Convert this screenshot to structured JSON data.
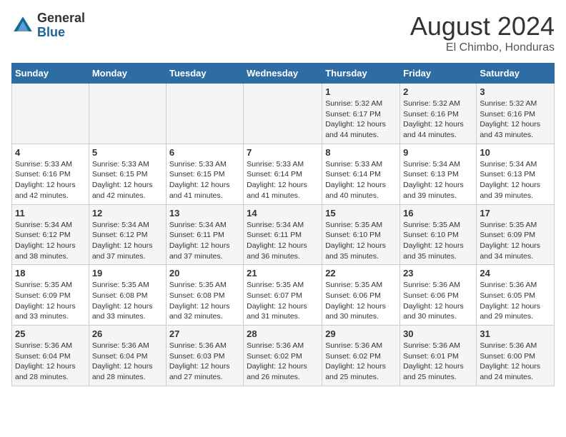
{
  "header": {
    "logo_general": "General",
    "logo_blue": "Blue",
    "title": "August 2024",
    "subtitle": "El Chimbo, Honduras"
  },
  "days_of_week": [
    "Sunday",
    "Monday",
    "Tuesday",
    "Wednesday",
    "Thursday",
    "Friday",
    "Saturday"
  ],
  "weeks": [
    [
      {
        "day": "",
        "info": ""
      },
      {
        "day": "",
        "info": ""
      },
      {
        "day": "",
        "info": ""
      },
      {
        "day": "",
        "info": ""
      },
      {
        "day": "1",
        "info": "Sunrise: 5:32 AM\nSunset: 6:17 PM\nDaylight: 12 hours\nand 44 minutes."
      },
      {
        "day": "2",
        "info": "Sunrise: 5:32 AM\nSunset: 6:16 PM\nDaylight: 12 hours\nand 44 minutes."
      },
      {
        "day": "3",
        "info": "Sunrise: 5:32 AM\nSunset: 6:16 PM\nDaylight: 12 hours\nand 43 minutes."
      }
    ],
    [
      {
        "day": "4",
        "info": "Sunrise: 5:33 AM\nSunset: 6:16 PM\nDaylight: 12 hours\nand 42 minutes."
      },
      {
        "day": "5",
        "info": "Sunrise: 5:33 AM\nSunset: 6:15 PM\nDaylight: 12 hours\nand 42 minutes."
      },
      {
        "day": "6",
        "info": "Sunrise: 5:33 AM\nSunset: 6:15 PM\nDaylight: 12 hours\nand 41 minutes."
      },
      {
        "day": "7",
        "info": "Sunrise: 5:33 AM\nSunset: 6:14 PM\nDaylight: 12 hours\nand 41 minutes."
      },
      {
        "day": "8",
        "info": "Sunrise: 5:33 AM\nSunset: 6:14 PM\nDaylight: 12 hours\nand 40 minutes."
      },
      {
        "day": "9",
        "info": "Sunrise: 5:34 AM\nSunset: 6:13 PM\nDaylight: 12 hours\nand 39 minutes."
      },
      {
        "day": "10",
        "info": "Sunrise: 5:34 AM\nSunset: 6:13 PM\nDaylight: 12 hours\nand 39 minutes."
      }
    ],
    [
      {
        "day": "11",
        "info": "Sunrise: 5:34 AM\nSunset: 6:12 PM\nDaylight: 12 hours\nand 38 minutes."
      },
      {
        "day": "12",
        "info": "Sunrise: 5:34 AM\nSunset: 6:12 PM\nDaylight: 12 hours\nand 37 minutes."
      },
      {
        "day": "13",
        "info": "Sunrise: 5:34 AM\nSunset: 6:11 PM\nDaylight: 12 hours\nand 37 minutes."
      },
      {
        "day": "14",
        "info": "Sunrise: 5:34 AM\nSunset: 6:11 PM\nDaylight: 12 hours\nand 36 minutes."
      },
      {
        "day": "15",
        "info": "Sunrise: 5:35 AM\nSunset: 6:10 PM\nDaylight: 12 hours\nand 35 minutes."
      },
      {
        "day": "16",
        "info": "Sunrise: 5:35 AM\nSunset: 6:10 PM\nDaylight: 12 hours\nand 35 minutes."
      },
      {
        "day": "17",
        "info": "Sunrise: 5:35 AM\nSunset: 6:09 PM\nDaylight: 12 hours\nand 34 minutes."
      }
    ],
    [
      {
        "day": "18",
        "info": "Sunrise: 5:35 AM\nSunset: 6:09 PM\nDaylight: 12 hours\nand 33 minutes."
      },
      {
        "day": "19",
        "info": "Sunrise: 5:35 AM\nSunset: 6:08 PM\nDaylight: 12 hours\nand 33 minutes."
      },
      {
        "day": "20",
        "info": "Sunrise: 5:35 AM\nSunset: 6:08 PM\nDaylight: 12 hours\nand 32 minutes."
      },
      {
        "day": "21",
        "info": "Sunrise: 5:35 AM\nSunset: 6:07 PM\nDaylight: 12 hours\nand 31 minutes."
      },
      {
        "day": "22",
        "info": "Sunrise: 5:35 AM\nSunset: 6:06 PM\nDaylight: 12 hours\nand 30 minutes."
      },
      {
        "day": "23",
        "info": "Sunrise: 5:36 AM\nSunset: 6:06 PM\nDaylight: 12 hours\nand 30 minutes."
      },
      {
        "day": "24",
        "info": "Sunrise: 5:36 AM\nSunset: 6:05 PM\nDaylight: 12 hours\nand 29 minutes."
      }
    ],
    [
      {
        "day": "25",
        "info": "Sunrise: 5:36 AM\nSunset: 6:04 PM\nDaylight: 12 hours\nand 28 minutes."
      },
      {
        "day": "26",
        "info": "Sunrise: 5:36 AM\nSunset: 6:04 PM\nDaylight: 12 hours\nand 28 minutes."
      },
      {
        "day": "27",
        "info": "Sunrise: 5:36 AM\nSunset: 6:03 PM\nDaylight: 12 hours\nand 27 minutes."
      },
      {
        "day": "28",
        "info": "Sunrise: 5:36 AM\nSunset: 6:02 PM\nDaylight: 12 hours\nand 26 minutes."
      },
      {
        "day": "29",
        "info": "Sunrise: 5:36 AM\nSunset: 6:02 PM\nDaylight: 12 hours\nand 25 minutes."
      },
      {
        "day": "30",
        "info": "Sunrise: 5:36 AM\nSunset: 6:01 PM\nDaylight: 12 hours\nand 25 minutes."
      },
      {
        "day": "31",
        "info": "Sunrise: 5:36 AM\nSunset: 6:00 PM\nDaylight: 12 hours\nand 24 minutes."
      }
    ]
  ]
}
